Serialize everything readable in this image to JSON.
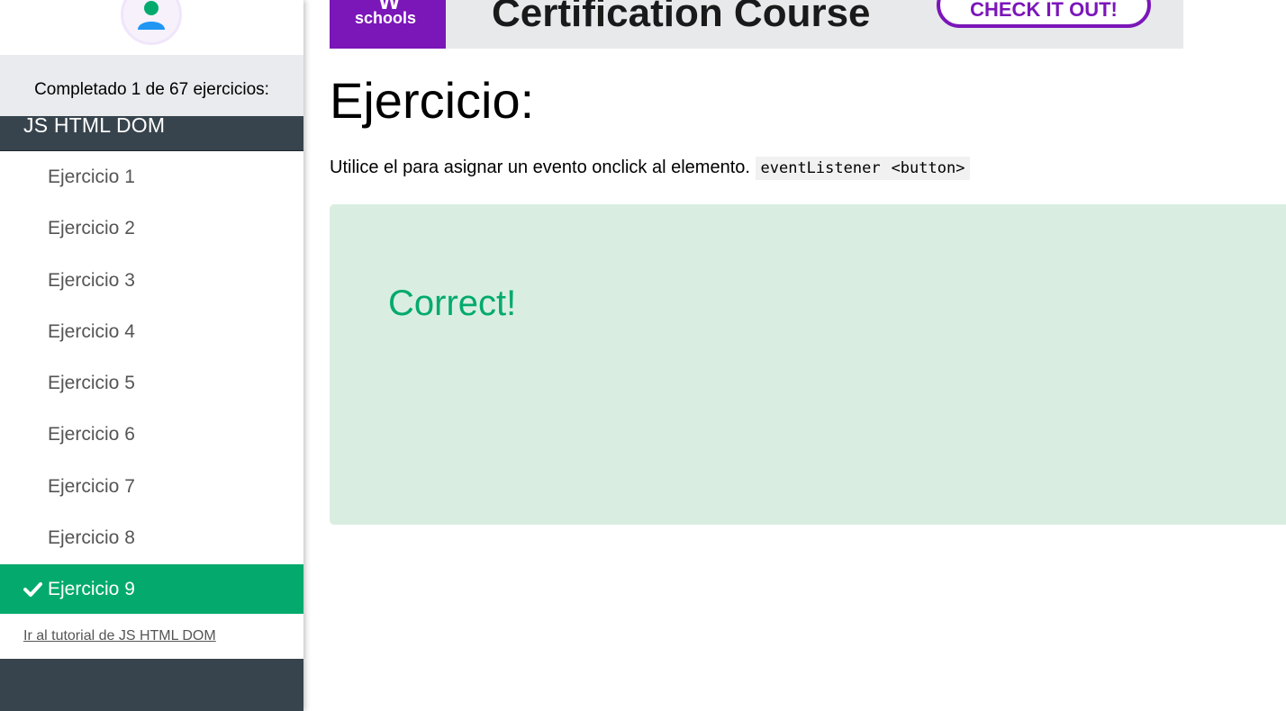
{
  "sidebar": {
    "progress_text": "Completado 1 de 67 ejercicios:",
    "section_title": "JS HTML DOM",
    "exercises": [
      {
        "label": "Ejercicio 1",
        "completed": false
      },
      {
        "label": "Ejercicio 2",
        "completed": false
      },
      {
        "label": "Ejercicio 3",
        "completed": false
      },
      {
        "label": "Ejercicio 4",
        "completed": false
      },
      {
        "label": "Ejercicio 5",
        "completed": false
      },
      {
        "label": "Ejercicio 6",
        "completed": false
      },
      {
        "label": "Ejercicio 7",
        "completed": false
      },
      {
        "label": "Ejercicio 8",
        "completed": false
      },
      {
        "label": "Ejercicio 9",
        "completed": true
      }
    ],
    "tutorial_link": "Ir al tutorial de JS HTML DOM"
  },
  "banner": {
    "logo_text": "schools",
    "title": "Certification Course",
    "cta_label": "CHECK IT OUT!"
  },
  "main": {
    "title": "Ejercicio:",
    "instruction_text": "Utilice el para asignar un evento onclick al elemento.",
    "code_1": "eventListener",
    "code_2": "<button>",
    "result_text": "Correct!"
  },
  "colors": {
    "accent_green": "#04aa6d",
    "sidebar_dark": "#38444d",
    "brand_purple": "#7b16b9",
    "result_bg": "#d9eee1"
  },
  "icons": [
    "user-avatar-icon",
    "check-icon"
  ]
}
